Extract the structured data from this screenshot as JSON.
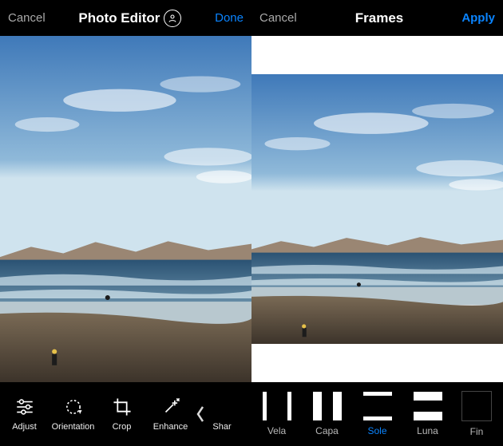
{
  "left": {
    "cancel": "Cancel",
    "title": "Photo Editor",
    "done": "Done",
    "tools": {
      "adjust": "Adjust",
      "orientation": "Orientation",
      "crop": "Crop",
      "enhance": "Enhance",
      "sharpen": "Shar"
    }
  },
  "right": {
    "cancel": "Cancel",
    "title": "Frames",
    "apply": "Apply",
    "frames": {
      "vela": "Vela",
      "capa": "Capa",
      "sole": "Sole",
      "luna": "Luna",
      "fine": "Fin"
    },
    "selected": "sole"
  }
}
